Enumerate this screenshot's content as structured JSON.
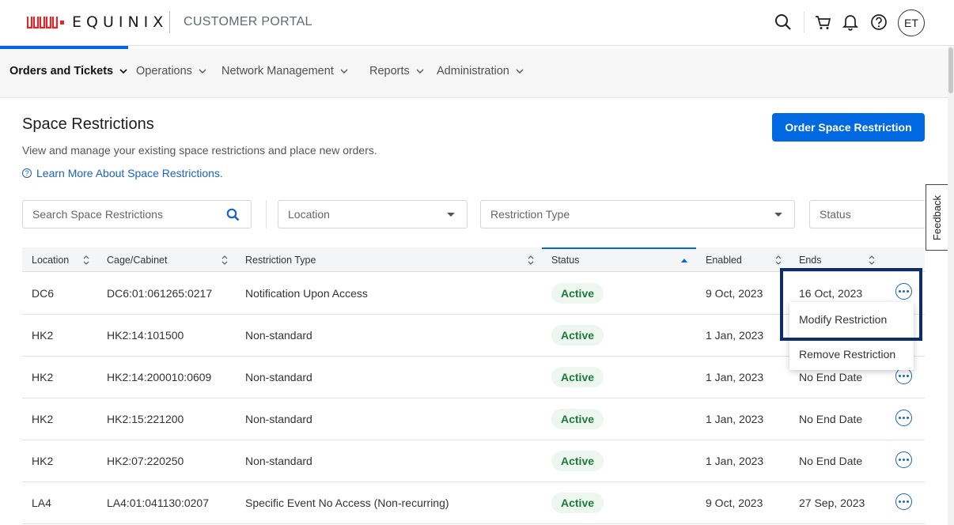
{
  "header": {
    "brand": "EQUINIX",
    "portal_title": "CUSTOMER PORTAL",
    "user_initials": "ET",
    "colors": {
      "brand_red": "#e3262a",
      "primary": "#0068e0"
    }
  },
  "nav": {
    "items": [
      {
        "label": "Orders and Tickets",
        "active": true
      },
      {
        "label": "Operations"
      },
      {
        "label": "Network Management"
      },
      {
        "label": "Reports"
      },
      {
        "label": "Administration"
      }
    ]
  },
  "page": {
    "title": "Space Restrictions",
    "description": "View and manage your existing space restrictions and place new orders.",
    "learn_more": "Learn More About Space Restrictions.",
    "order_button": "Order Space Restriction"
  },
  "filters": {
    "search_placeholder": "Search Space Restrictions",
    "location": "Location",
    "restriction_type": "Restriction Type",
    "status": "Status"
  },
  "feedback": "Feedback",
  "table": {
    "columns": [
      "Location",
      "Cage/Cabinet",
      "Restriction Type",
      "Status",
      "Enabled",
      "Ends"
    ],
    "rows": [
      {
        "location": "DC6",
        "cage": "DC6:01:061265:0217",
        "type": "Notification Upon Access",
        "status": "Active",
        "enabled": "9 Oct, 2023",
        "ends": "16 Oct, 2023"
      },
      {
        "location": "HK2",
        "cage": "HK2:14:101500",
        "type": "Non-standard",
        "status": "Active",
        "enabled": "1 Jan, 2023",
        "ends": ""
      },
      {
        "location": "HK2",
        "cage": "HK2:14:200010:0609",
        "type": "Non-standard",
        "status": "Active",
        "enabled": "1 Jan, 2023",
        "ends": "No End Date"
      },
      {
        "location": "HK2",
        "cage": "HK2:15:221200",
        "type": "Non-standard",
        "status": "Active",
        "enabled": "1 Jan, 2023",
        "ends": "No End Date"
      },
      {
        "location": "HK2",
        "cage": "HK2:07:220250",
        "type": "Non-standard",
        "status": "Active",
        "enabled": "1 Jan, 2023",
        "ends": "No End Date"
      },
      {
        "location": "LA4",
        "cage": "LA4:01:041130:0207",
        "type": "Specific Event No Access (Non-recurring)",
        "status": "Active",
        "enabled": "9 Oct, 2023",
        "ends": "27 Sep, 2023"
      }
    ]
  },
  "row_menu": {
    "modify": "Modify Restriction",
    "remove": "Remove Restriction"
  }
}
